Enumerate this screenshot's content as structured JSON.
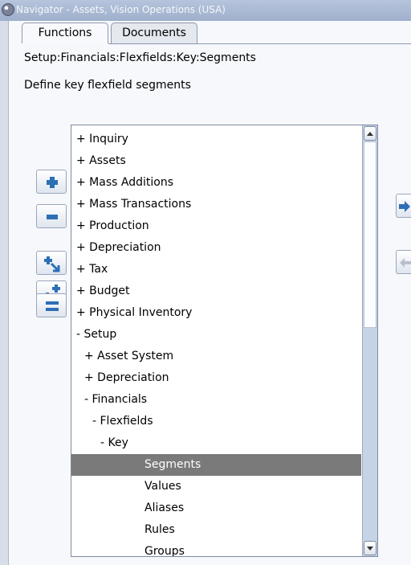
{
  "window": {
    "title": "Navigator - Assets, Vision Operations (USA)"
  },
  "tabs": [
    {
      "label": "Functions",
      "active": true
    },
    {
      "label": "Documents",
      "active": false
    }
  ],
  "navigator": {
    "path": "Setup:Financials:Flexfields:Key:Segments",
    "description": "Define key flexfield segments"
  },
  "toolbar": {
    "buttons": [
      {
        "name": "expand-icon"
      },
      {
        "name": "collapse-icon"
      },
      {
        "name": "expand-branch-icon"
      },
      {
        "name": "expand-all-icon"
      },
      {
        "name": "collapse-all-icon"
      }
    ]
  },
  "side_buttons": [
    {
      "name": "add-to-top-ten-icon"
    },
    {
      "name": "remove-from-top-ten-icon"
    }
  ],
  "tree": {
    "rows": [
      {
        "text": "+ Inquiry",
        "depth": 0
      },
      {
        "text": "+ Assets",
        "depth": 0
      },
      {
        "text": "+ Mass Additions",
        "depth": 0
      },
      {
        "text": "+ Mass Transactions",
        "depth": 0
      },
      {
        "text": "+ Production",
        "depth": 0
      },
      {
        "text": "+ Depreciation",
        "depth": 0
      },
      {
        "text": "+ Tax",
        "depth": 0
      },
      {
        "text": "+ Budget",
        "depth": 0
      },
      {
        "text": "+ Physical Inventory",
        "depth": 0
      },
      {
        "text": "- Setup",
        "depth": 0
      },
      {
        "text": "+ Asset System",
        "depth": 1
      },
      {
        "text": "+ Depreciation",
        "depth": 1
      },
      {
        "text": "- Financials",
        "depth": 1
      },
      {
        "text": "- Flexfields",
        "depth": 2
      },
      {
        "text": "- Key",
        "depth": 3
      },
      {
        "text": "Segments",
        "depth": 5,
        "selected": true
      },
      {
        "text": "Values",
        "depth": 5
      },
      {
        "text": "Aliases",
        "depth": 5
      },
      {
        "text": "Rules",
        "depth": 5
      },
      {
        "text": "Groups",
        "depth": 5
      }
    ]
  }
}
